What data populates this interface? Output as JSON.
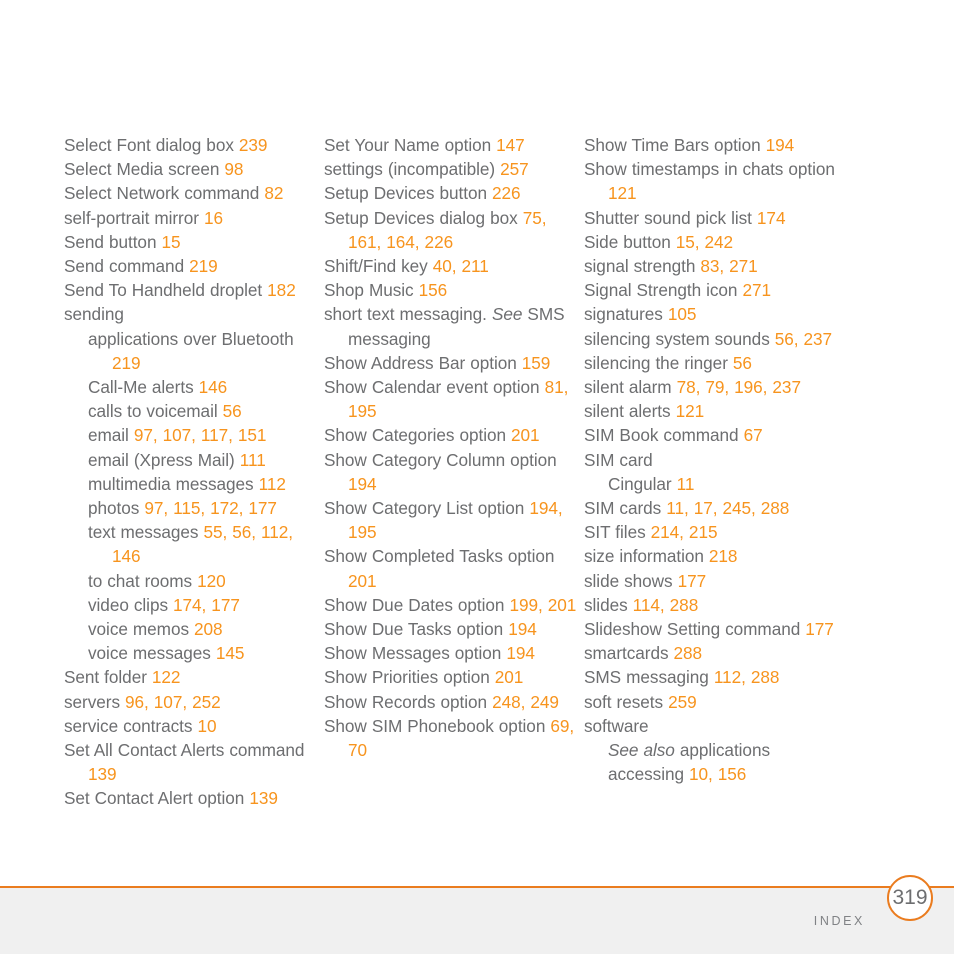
{
  "footer": {
    "label": "INDEX",
    "page_number": "319",
    "rule_color": "#ea7c1f",
    "band_color": "#f0f0f0"
  },
  "colors": {
    "text": "#6d6e70",
    "page_reference": "#f7941e"
  },
  "index": {
    "columns": [
      {
        "entries": [
          {
            "level": 0,
            "parts": [
              {
                "t": "Select Font dialog box ",
                "k": "text"
              },
              {
                "t": "239",
                "k": "page"
              }
            ]
          },
          {
            "level": 0,
            "parts": [
              {
                "t": "Select Media screen ",
                "k": "text"
              },
              {
                "t": "98",
                "k": "page"
              }
            ]
          },
          {
            "level": 0,
            "parts": [
              {
                "t": "Select Network command ",
                "k": "text"
              },
              {
                "t": "82",
                "k": "page"
              }
            ]
          },
          {
            "level": 0,
            "parts": [
              {
                "t": "self-portrait mirror ",
                "k": "text"
              },
              {
                "t": "16",
                "k": "page"
              }
            ]
          },
          {
            "level": 0,
            "parts": [
              {
                "t": "Send button ",
                "k": "text"
              },
              {
                "t": "15",
                "k": "page"
              }
            ]
          },
          {
            "level": 0,
            "parts": [
              {
                "t": "Send command ",
                "k": "text"
              },
              {
                "t": "219",
                "k": "page"
              }
            ]
          },
          {
            "level": 0,
            "parts": [
              {
                "t": "Send To Handheld droplet ",
                "k": "text"
              },
              {
                "t": "182",
                "k": "page"
              }
            ]
          },
          {
            "level": 0,
            "parts": [
              {
                "t": "sending",
                "k": "text"
              }
            ]
          },
          {
            "level": 1,
            "parts": [
              {
                "t": "applications over Bluetooth ",
                "k": "text"
              },
              {
                "t": "219",
                "k": "page"
              }
            ]
          },
          {
            "level": 1,
            "parts": [
              {
                "t": "Call-Me alerts ",
                "k": "text"
              },
              {
                "t": "146",
                "k": "page"
              }
            ]
          },
          {
            "level": 1,
            "parts": [
              {
                "t": "calls to voicemail ",
                "k": "text"
              },
              {
                "t": "56",
                "k": "page"
              }
            ]
          },
          {
            "level": 1,
            "parts": [
              {
                "t": "email ",
                "k": "text"
              },
              {
                "t": "97, 107, 117, 151",
                "k": "page"
              }
            ]
          },
          {
            "level": 1,
            "parts": [
              {
                "t": "email (Xpress Mail) ",
                "k": "text"
              },
              {
                "t": "111",
                "k": "page"
              }
            ]
          },
          {
            "level": 1,
            "parts": [
              {
                "t": "multimedia messages ",
                "k": "text"
              },
              {
                "t": "112",
                "k": "page"
              }
            ]
          },
          {
            "level": 1,
            "parts": [
              {
                "t": "photos ",
                "k": "text"
              },
              {
                "t": "97, 115, 172, 177",
                "k": "page"
              }
            ]
          },
          {
            "level": 1,
            "parts": [
              {
                "t": "text messages ",
                "k": "text"
              },
              {
                "t": "55, 56, 112, 146",
                "k": "page"
              }
            ]
          },
          {
            "level": 1,
            "parts": [
              {
                "t": "to chat rooms ",
                "k": "text"
              },
              {
                "t": "120",
                "k": "page"
              }
            ]
          },
          {
            "level": 1,
            "parts": [
              {
                "t": "video clips ",
                "k": "text"
              },
              {
                "t": "174, 177",
                "k": "page"
              }
            ]
          },
          {
            "level": 1,
            "parts": [
              {
                "t": "voice memos ",
                "k": "text"
              },
              {
                "t": "208",
                "k": "page"
              }
            ]
          },
          {
            "level": 1,
            "parts": [
              {
                "t": "voice messages ",
                "k": "text"
              },
              {
                "t": "145",
                "k": "page"
              }
            ]
          },
          {
            "level": 0,
            "parts": [
              {
                "t": "Sent folder ",
                "k": "text"
              },
              {
                "t": "122",
                "k": "page"
              }
            ]
          },
          {
            "level": 0,
            "parts": [
              {
                "t": "servers ",
                "k": "text"
              },
              {
                "t": "96, 107, 252",
                "k": "page"
              }
            ]
          },
          {
            "level": 0,
            "parts": [
              {
                "t": "service contracts ",
                "k": "text"
              },
              {
                "t": "10",
                "k": "page"
              }
            ]
          },
          {
            "level": 0,
            "parts": [
              {
                "t": "Set All Contact Alerts command ",
                "k": "text"
              },
              {
                "t": "139",
                "k": "page"
              }
            ]
          },
          {
            "level": 0,
            "parts": [
              {
                "t": "Set Contact Alert option ",
                "k": "text"
              },
              {
                "t": "139",
                "k": "page"
              }
            ]
          }
        ]
      },
      {
        "entries": [
          {
            "level": 0,
            "parts": [
              {
                "t": "Set Your Name option ",
                "k": "text"
              },
              {
                "t": "147",
                "k": "page"
              }
            ]
          },
          {
            "level": 0,
            "parts": [
              {
                "t": "settings (incompatible) ",
                "k": "text"
              },
              {
                "t": "257",
                "k": "page"
              }
            ]
          },
          {
            "level": 0,
            "parts": [
              {
                "t": "Setup Devices button ",
                "k": "text"
              },
              {
                "t": "226",
                "k": "page"
              }
            ]
          },
          {
            "level": 0,
            "parts": [
              {
                "t": "Setup Devices dialog box ",
                "k": "text"
              },
              {
                "t": "75, 161, 164, 226",
                "k": "page"
              }
            ]
          },
          {
            "level": 0,
            "parts": [
              {
                "t": "Shift/Find key ",
                "k": "text"
              },
              {
                "t": "40, 211",
                "k": "page"
              }
            ]
          },
          {
            "level": 0,
            "parts": [
              {
                "t": "Shop Music ",
                "k": "text"
              },
              {
                "t": "156",
                "k": "page"
              }
            ]
          },
          {
            "level": 0,
            "parts": [
              {
                "t": "short text messaging. ",
                "k": "text"
              },
              {
                "t": "See",
                "k": "italic"
              },
              {
                "t": " SMS messaging",
                "k": "text"
              }
            ]
          },
          {
            "level": 0,
            "parts": [
              {
                "t": "Show Address Bar option ",
                "k": "text"
              },
              {
                "t": "159",
                "k": "page"
              }
            ]
          },
          {
            "level": 0,
            "parts": [
              {
                "t": "Show Calendar event option ",
                "k": "text"
              },
              {
                "t": "81, 195",
                "k": "page"
              }
            ]
          },
          {
            "level": 0,
            "parts": [
              {
                "t": "Show Categories option ",
                "k": "text"
              },
              {
                "t": "201",
                "k": "page"
              }
            ]
          },
          {
            "level": 0,
            "parts": [
              {
                "t": "Show Category Column option ",
                "k": "text"
              },
              {
                "t": "194",
                "k": "page"
              }
            ]
          },
          {
            "level": 0,
            "parts": [
              {
                "t": "Show Category List option ",
                "k": "text"
              },
              {
                "t": "194, 195",
                "k": "page"
              }
            ]
          },
          {
            "level": 0,
            "parts": [
              {
                "t": "Show Completed Tasks option ",
                "k": "text"
              },
              {
                "t": "201",
                "k": "page"
              }
            ]
          },
          {
            "level": 0,
            "parts": [
              {
                "t": "Show Due Dates option ",
                "k": "text"
              },
              {
                "t": "199, 201",
                "k": "page"
              }
            ]
          },
          {
            "level": 0,
            "parts": [
              {
                "t": "Show Due Tasks option ",
                "k": "text"
              },
              {
                "t": "194",
                "k": "page"
              }
            ]
          },
          {
            "level": 0,
            "parts": [
              {
                "t": "Show Messages option ",
                "k": "text"
              },
              {
                "t": "194",
                "k": "page"
              }
            ]
          },
          {
            "level": 0,
            "parts": [
              {
                "t": "Show Priorities option ",
                "k": "text"
              },
              {
                "t": "201",
                "k": "page"
              }
            ]
          },
          {
            "level": 0,
            "parts": [
              {
                "t": "Show Records option ",
                "k": "text"
              },
              {
                "t": "248, 249",
                "k": "page"
              }
            ]
          },
          {
            "level": 0,
            "parts": [
              {
                "t": "Show SIM Phonebook option ",
                "k": "text"
              },
              {
                "t": "69, 70",
                "k": "page"
              }
            ]
          }
        ]
      },
      {
        "entries": [
          {
            "level": 0,
            "parts": [
              {
                "t": "Show Time Bars option ",
                "k": "text"
              },
              {
                "t": "194",
                "k": "page"
              }
            ]
          },
          {
            "level": 0,
            "parts": [
              {
                "t": "Show timestamps in chats option ",
                "k": "text"
              },
              {
                "t": "121",
                "k": "page"
              }
            ]
          },
          {
            "level": 0,
            "parts": [
              {
                "t": "Shutter sound pick list ",
                "k": "text"
              },
              {
                "t": "174",
                "k": "page"
              }
            ]
          },
          {
            "level": 0,
            "parts": [
              {
                "t": "Side button ",
                "k": "text"
              },
              {
                "t": "15, 242",
                "k": "page"
              }
            ]
          },
          {
            "level": 0,
            "parts": [
              {
                "t": "signal strength ",
                "k": "text"
              },
              {
                "t": "83, 271",
                "k": "page"
              }
            ]
          },
          {
            "level": 0,
            "parts": [
              {
                "t": "Signal Strength icon ",
                "k": "text"
              },
              {
                "t": "271",
                "k": "page"
              }
            ]
          },
          {
            "level": 0,
            "parts": [
              {
                "t": "signatures ",
                "k": "text"
              },
              {
                "t": "105",
                "k": "page"
              }
            ]
          },
          {
            "level": 0,
            "parts": [
              {
                "t": "silencing system sounds ",
                "k": "text"
              },
              {
                "t": "56, 237",
                "k": "page"
              }
            ]
          },
          {
            "level": 0,
            "parts": [
              {
                "t": "silencing the ringer ",
                "k": "text"
              },
              {
                "t": "56",
                "k": "page"
              }
            ]
          },
          {
            "level": 0,
            "parts": [
              {
                "t": "silent alarm ",
                "k": "text"
              },
              {
                "t": "78, 79, 196, 237",
                "k": "page"
              }
            ]
          },
          {
            "level": 0,
            "parts": [
              {
                "t": "silent alerts ",
                "k": "text"
              },
              {
                "t": "121",
                "k": "page"
              }
            ]
          },
          {
            "level": 0,
            "parts": [
              {
                "t": "SIM Book command ",
                "k": "text"
              },
              {
                "t": "67",
                "k": "page"
              }
            ]
          },
          {
            "level": 0,
            "parts": [
              {
                "t": "SIM card",
                "k": "text"
              }
            ]
          },
          {
            "level": 1,
            "parts": [
              {
                "t": "Cingular ",
                "k": "text"
              },
              {
                "t": "11",
                "k": "page"
              }
            ]
          },
          {
            "level": 0,
            "parts": [
              {
                "t": "SIM cards ",
                "k": "text"
              },
              {
                "t": "11, 17, 245, 288",
                "k": "page"
              }
            ]
          },
          {
            "level": 0,
            "parts": [
              {
                "t": "SIT files ",
                "k": "text"
              },
              {
                "t": "214, 215",
                "k": "page"
              }
            ]
          },
          {
            "level": 0,
            "parts": [
              {
                "t": "size information ",
                "k": "text"
              },
              {
                "t": "218",
                "k": "page"
              }
            ]
          },
          {
            "level": 0,
            "parts": [
              {
                "t": "slide shows ",
                "k": "text"
              },
              {
                "t": "177",
                "k": "page"
              }
            ]
          },
          {
            "level": 0,
            "parts": [
              {
                "t": "slides ",
                "k": "text"
              },
              {
                "t": "114, 288",
                "k": "page"
              }
            ]
          },
          {
            "level": 0,
            "parts": [
              {
                "t": "Slideshow Setting command ",
                "k": "text"
              },
              {
                "t": "177",
                "k": "page"
              }
            ]
          },
          {
            "level": 0,
            "parts": [
              {
                "t": "smartcards ",
                "k": "text"
              },
              {
                "t": "288",
                "k": "page"
              }
            ]
          },
          {
            "level": 0,
            "parts": [
              {
                "t": "SMS messaging ",
                "k": "text"
              },
              {
                "t": "112, 288",
                "k": "page"
              }
            ]
          },
          {
            "level": 0,
            "parts": [
              {
                "t": "soft resets ",
                "k": "text"
              },
              {
                "t": "259",
                "k": "page"
              }
            ]
          },
          {
            "level": 0,
            "parts": [
              {
                "t": "software",
                "k": "text"
              }
            ]
          },
          {
            "level": 1,
            "parts": [
              {
                "t": "See also",
                "k": "italic"
              },
              {
                "t": " applications",
                "k": "text"
              }
            ]
          },
          {
            "level": 1,
            "parts": [
              {
                "t": "accessing ",
                "k": "text"
              },
              {
                "t": "10, 156",
                "k": "page"
              }
            ]
          }
        ]
      }
    ]
  }
}
